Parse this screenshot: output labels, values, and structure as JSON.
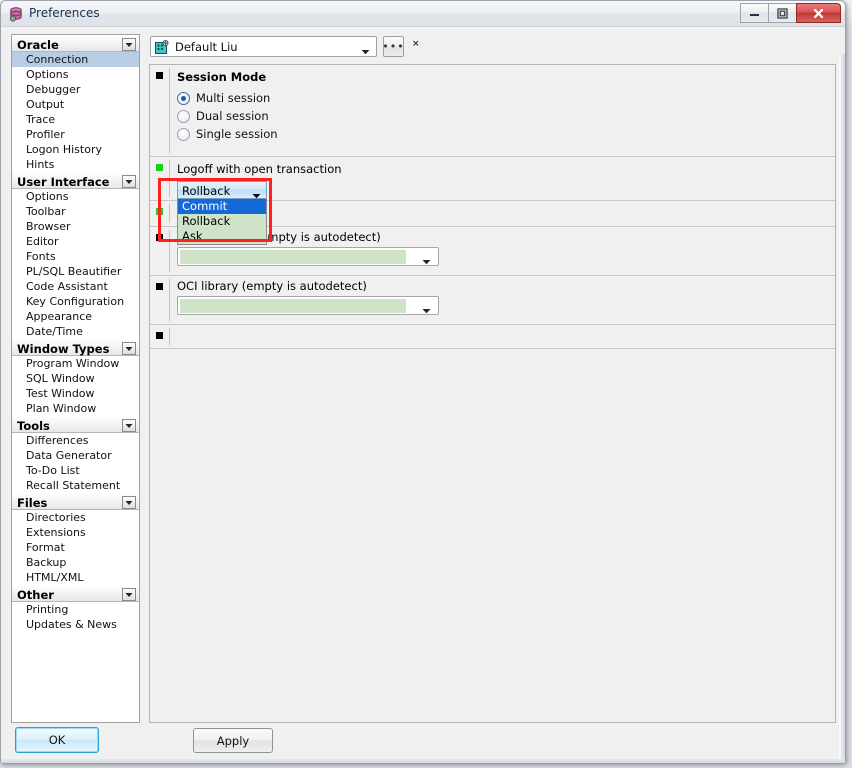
{
  "window": {
    "title": "Preferences",
    "title_icon": "database-icon",
    "minimize_label": "–",
    "maximize_label": "▣",
    "close_label": "✕"
  },
  "sidebar": {
    "groups": [
      {
        "header": "Oracle",
        "collapse_icon": "chevron-down-icon",
        "items": [
          {
            "label": "Connection",
            "selected": true
          },
          {
            "label": "Options",
            "selected": false
          },
          {
            "label": "Debugger",
            "selected": false
          },
          {
            "label": "Output",
            "selected": false
          },
          {
            "label": "Trace",
            "selected": false
          },
          {
            "label": "Profiler",
            "selected": false
          },
          {
            "label": "Logon History",
            "selected": false
          },
          {
            "label": "Hints",
            "selected": false
          }
        ]
      },
      {
        "header": "User Interface",
        "collapse_icon": "chevron-down-icon",
        "items": [
          {
            "label": "Options",
            "selected": false
          },
          {
            "label": "Toolbar",
            "selected": false
          },
          {
            "label": "Browser",
            "selected": false
          },
          {
            "label": "Editor",
            "selected": false
          },
          {
            "label": "Fonts",
            "selected": false
          },
          {
            "label": "PL/SQL Beautifier",
            "selected": false
          },
          {
            "label": "Code Assistant",
            "selected": false
          },
          {
            "label": "Key Configuration",
            "selected": false
          },
          {
            "label": "Appearance",
            "selected": false
          },
          {
            "label": "Date/Time",
            "selected": false
          }
        ]
      },
      {
        "header": "Window Types",
        "collapse_icon": "chevron-down-icon",
        "items": [
          {
            "label": "Program Window",
            "selected": false
          },
          {
            "label": "SQL Window",
            "selected": false
          },
          {
            "label": "Test Window",
            "selected": false
          },
          {
            "label": "Plan Window",
            "selected": false
          }
        ]
      },
      {
        "header": "Tools",
        "collapse_icon": "chevron-down-icon",
        "items": [
          {
            "label": "Differences",
            "selected": false
          },
          {
            "label": "Data Generator",
            "selected": false
          },
          {
            "label": "To-Do List",
            "selected": false
          },
          {
            "label": "Recall Statement",
            "selected": false
          }
        ]
      },
      {
        "header": "Files",
        "collapse_icon": "chevron-down-icon",
        "items": [
          {
            "label": "Directories",
            "selected": false
          },
          {
            "label": "Extensions",
            "selected": false
          },
          {
            "label": "Format",
            "selected": false
          },
          {
            "label": "Backup",
            "selected": false
          },
          {
            "label": "HTML/XML",
            "selected": false
          }
        ]
      },
      {
        "header": "Other",
        "collapse_icon": "chevron-down-icon",
        "items": [
          {
            "label": "Printing",
            "selected": false
          },
          {
            "label": "Updates & News",
            "selected": false
          }
        ]
      }
    ]
  },
  "profile_bar": {
    "icon": "user-profile-icon",
    "value": "Default Liu",
    "dropdown_icon": "chevron-down-icon",
    "browse_label": "•••",
    "extra_glyph": "×"
  },
  "settings": {
    "session_mode": {
      "title": "Session Mode",
      "marker": "black",
      "options": [
        {
          "label": "Multi session",
          "checked": true
        },
        {
          "label": "Dual session",
          "checked": false
        },
        {
          "label": "Single session",
          "checked": false
        }
      ]
    },
    "logoff": {
      "label": "Logoff with open transaction",
      "marker": "green",
      "selected_value": "Rollback",
      "dropdown_icon": "chevron-down-icon",
      "options": [
        {
          "label": "Commit",
          "highlighted": true
        },
        {
          "label": "Rollback",
          "highlighted": false
        },
        {
          "label": "Ask",
          "highlighted": false
        }
      ]
    },
    "hidden_green_row": {
      "marker": "green"
    },
    "oracle_home": {
      "label": "Oracle Home (empty is autodetect)",
      "marker": "black",
      "value": "",
      "dropdown_icon": "chevron-down-icon"
    },
    "oci_library": {
      "label": "OCI library (empty is autodetect)",
      "marker": "black",
      "value": "",
      "dropdown_icon": "chevron-down-icon"
    },
    "empty_row": {
      "marker": "black"
    }
  },
  "footer": {
    "ok_label": "OK",
    "apply_label": "Apply"
  },
  "colors": {
    "selection_blue": "#b6cde4",
    "highlight_blue": "#1569d6",
    "field_green": "#cfe3c8",
    "marker_green": "#15d215",
    "annotation_red": "#ff2020",
    "close_red": "#c03832"
  }
}
